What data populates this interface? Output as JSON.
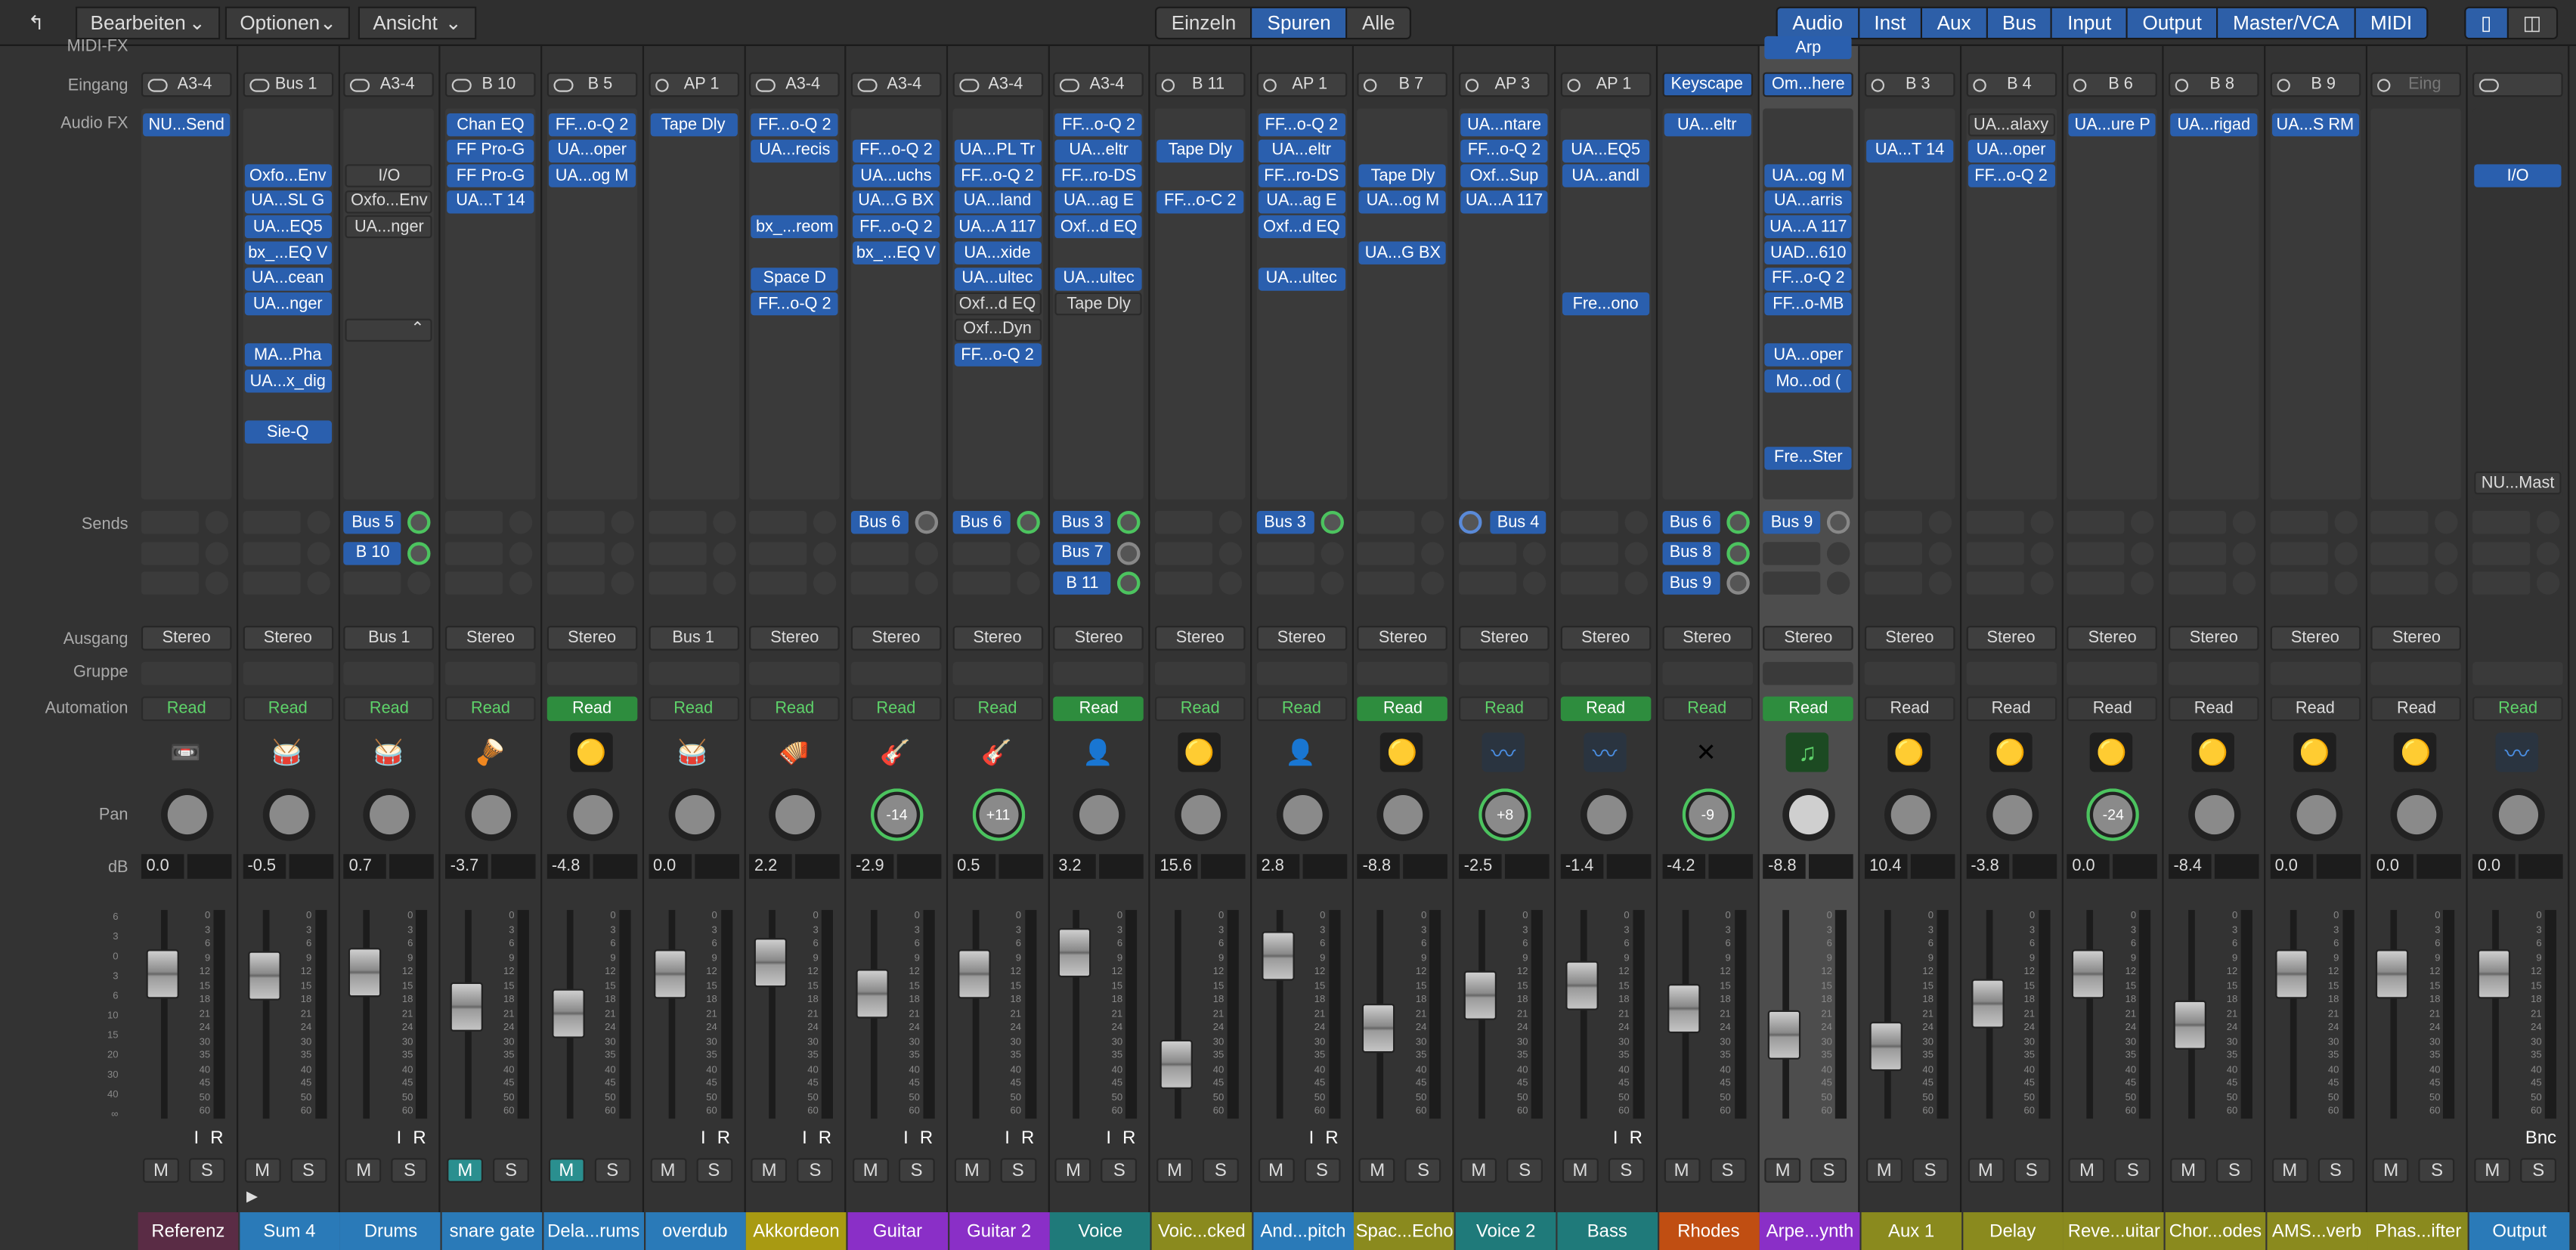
{
  "toolbar": {
    "back_icon": "back-arrow-icon",
    "menus": [
      "Bearbeiten",
      "Optionen",
      "Ansicht"
    ],
    "view_filter": [
      "Einzeln",
      "Spuren",
      "Alle"
    ],
    "view_filter_active": "Spuren",
    "types": [
      "Audio",
      "Inst",
      "Aux",
      "Bus",
      "Input",
      "Output",
      "Master/VCA",
      "MIDI"
    ],
    "types_active": [
      "Audio"
    ]
  },
  "row_labels": {
    "midi_fx": "MIDI-FX",
    "input": "Eingang",
    "audio_fx": "Audio FX",
    "sends": "Sends",
    "output": "Ausgang",
    "group": "Gruppe",
    "automation": "Automation",
    "pan": "Pan",
    "db": "dB"
  },
  "fader_scale": [
    "6",
    "3",
    "0",
    "3",
    "6",
    "10",
    "15",
    "20",
    "30",
    "40",
    "∞"
  ],
  "meter_scale": [
    "0",
    "3",
    "6",
    "9",
    "12",
    "15",
    "18",
    "21",
    "24",
    "30",
    "35",
    "40",
    "45",
    "50",
    "60"
  ],
  "strips": [
    {
      "name": "Referenz",
      "color": "#5a2c45",
      "input": "A3-4",
      "stereo": true,
      "fx": [
        {
          "s": 0,
          "t": "NU...Send",
          "c": "b"
        }
      ],
      "sends": [],
      "output": "Stereo",
      "automation": "Read",
      "auto_style": "n",
      "icon": "tape-machine-icon",
      "pan": "",
      "db": "0.0",
      "fader_level": 0.78,
      "ir": true
    },
    {
      "name": "Sum 4",
      "color": "#2a7ab8",
      "input": "Bus 1",
      "stereo": true,
      "fx": [
        {
          "s": 2,
          "t": "Oxfo...Env",
          "c": "b"
        },
        {
          "s": 3,
          "t": "UA...SL G",
          "c": "b"
        },
        {
          "s": 4,
          "t": "UA...EQ5",
          "c": "b"
        },
        {
          "s": 5,
          "t": "bx_...EQ V",
          "c": "b"
        },
        {
          "s": 6,
          "t": "UA...cean",
          "c": "b"
        },
        {
          "s": 7,
          "t": "UA...nger",
          "c": "b"
        },
        {
          "s": 9,
          "t": "MA...Pha",
          "c": "b"
        },
        {
          "s": 10,
          "t": "UA...x_dig",
          "c": "b"
        },
        {
          "s": 12,
          "t": "Sie-Q",
          "c": "b"
        }
      ],
      "sends": [],
      "output": "Stereo",
      "automation": "Read",
      "auto_style": "n",
      "icon": "drum-kit-icon",
      "pan": "",
      "db": "-0.5",
      "fader_level": 0.77
    },
    {
      "name": "Drums",
      "color": "#2a7ab8",
      "input": "A3-4",
      "stereo": true,
      "fx": [
        {
          "s": 2,
          "t": "I/O",
          "c": "g"
        },
        {
          "s": 3,
          "t": "Oxfo...Env",
          "c": "g"
        },
        {
          "s": 4,
          "t": "UA...nger",
          "c": "g"
        },
        {
          "s": 8,
          "t": "",
          "c": "g"
        }
      ],
      "sends": [
        {
          "t": "Bus 5",
          "k": "g"
        },
        {
          "t": "B 10",
          "k": "g"
        }
      ],
      "output": "Bus 1",
      "automation": "Read",
      "auto_style": "n",
      "icon": "drum-kit-icon",
      "pan": "",
      "db": "0.7",
      "fader_level": 0.79,
      "ir": true
    },
    {
      "name": "snare gate",
      "color": "#2a7ab8",
      "input": "B 10",
      "stereo": true,
      "fx": [
        {
          "s": 0,
          "t": "Chan EQ",
          "c": "b"
        },
        {
          "s": 1,
          "t": "FF Pro-G",
          "c": "b"
        },
        {
          "s": 2,
          "t": "FF Pro-G",
          "c": "b"
        },
        {
          "s": 3,
          "t": "UA...T 14",
          "c": "b"
        }
      ],
      "sends": [],
      "output": "Stereo",
      "automation": "Read",
      "auto_style": "n",
      "icon": "snare-drum-icon",
      "pan": "",
      "db": "-3.7",
      "fader_level": 0.6,
      "mute_on": true
    },
    {
      "name": "Dela...rums",
      "color": "#2a7ab8",
      "input": "B 5",
      "stereo": true,
      "fx": [
        {
          "s": 0,
          "t": "FF...o-Q 2",
          "c": "b"
        },
        {
          "s": 1,
          "t": "UA...oper",
          "c": "b"
        },
        {
          "s": 2,
          "t": "UA...og M",
          "c": "b"
        }
      ],
      "sends": [],
      "output": "Stereo",
      "automation": "Read",
      "auto_style": "h",
      "icon": "plugin-knob-icon",
      "pan": "",
      "db": "-4.8",
      "fader_level": 0.56,
      "mute_on": true
    },
    {
      "name": "overdub",
      "color": "#2a7ab8",
      "input": "AP 1",
      "stereo": false,
      "fx": [
        {
          "s": 0,
          "t": "Tape Dly",
          "c": "b"
        }
      ],
      "sends": [],
      "output": "Bus 1",
      "automation": "Read",
      "auto_style": "n",
      "icon": "drum-kit-icon",
      "pan": "",
      "db": "0.0",
      "fader_level": 0.78,
      "ir": true
    },
    {
      "name": "Akkordeon",
      "color": "#a89a12",
      "input": "A3-4",
      "stereo": true,
      "fx": [
        {
          "s": 0,
          "t": "FF...o-Q 2",
          "c": "b"
        },
        {
          "s": 1,
          "t": "UA...recis",
          "c": "b"
        },
        {
          "s": 4,
          "t": "bx_...reom",
          "c": "b"
        },
        {
          "s": 6,
          "t": "Space D",
          "c": "b"
        },
        {
          "s": 7,
          "t": "FF...o-Q 2",
          "c": "b"
        }
      ],
      "sends": [],
      "output": "Stereo",
      "automation": "Read",
      "auto_style": "n",
      "icon": "accordion-icon",
      "pan": "",
      "db": "2.2",
      "fader_level": 0.85,
      "ir": true
    },
    {
      "name": "Guitar",
      "color": "#8a2fc7",
      "input": "A3-4",
      "stereo": true,
      "fx": [
        {
          "s": 1,
          "t": "FF...o-Q 2",
          "c": "b"
        },
        {
          "s": 2,
          "t": "UA...uchs",
          "c": "b"
        },
        {
          "s": 3,
          "t": "UA...G BX",
          "c": "b"
        },
        {
          "s": 4,
          "t": "FF...o-Q 2",
          "c": "b"
        },
        {
          "s": 5,
          "t": "bx_...EQ V",
          "c": "b"
        }
      ],
      "sends": [
        {
          "t": "Bus 6",
          "k": "gr"
        }
      ],
      "output": "Stereo",
      "automation": "Read",
      "auto_style": "n",
      "icon": "electric-guitar-icon",
      "pan": "-14",
      "db": "-2.9",
      "fader_level": 0.67,
      "ir": true
    },
    {
      "name": "Guitar 2",
      "color": "#8a2fc7",
      "input": "A3-4",
      "stereo": true,
      "fx": [
        {
          "s": 1,
          "t": "UA...PL Tr",
          "c": "b"
        },
        {
          "s": 2,
          "t": "FF...o-Q 2",
          "c": "b"
        },
        {
          "s": 3,
          "t": "UA...land",
          "c": "b"
        },
        {
          "s": 4,
          "t": "UA...A 117",
          "c": "b"
        },
        {
          "s": 5,
          "t": "UA...xide",
          "c": "b"
        },
        {
          "s": 6,
          "t": "UA...ultec",
          "c": "b"
        },
        {
          "s": 7,
          "t": "Oxf...d EQ",
          "c": "g"
        },
        {
          "s": 8,
          "t": "Oxf...Dyn",
          "c": "g"
        },
        {
          "s": 9,
          "t": "FF...o-Q 2",
          "c": "b"
        }
      ],
      "sends": [
        {
          "t": "Bus 6",
          "k": "g"
        }
      ],
      "output": "Stereo",
      "automation": "Read",
      "auto_style": "n",
      "icon": "electric-guitar-icon",
      "pan": "+11",
      "db": "0.5",
      "fader_level": 0.78,
      "ir": true
    },
    {
      "name": "Voice",
      "color": "#1f7a7a",
      "input": "A3-4",
      "stereo": true,
      "fx": [
        {
          "s": 0,
          "t": "FF...o-Q 2",
          "c": "b"
        },
        {
          "s": 1,
          "t": "UA...eltr",
          "c": "b"
        },
        {
          "s": 2,
          "t": "FF...ro-DS",
          "c": "b"
        },
        {
          "s": 3,
          "t": "UA...ag E",
          "c": "b"
        },
        {
          "s": 4,
          "t": "Oxf...d EQ",
          "c": "b"
        },
        {
          "s": 6,
          "t": "UA...ultec",
          "c": "b"
        },
        {
          "s": 7,
          "t": "Tape Dly",
          "c": "g"
        }
      ],
      "sends": [
        {
          "t": "Bus 3",
          "k": "g"
        },
        {
          "t": "Bus 7",
          "k": "gr"
        },
        {
          "t": "B 11",
          "k": "g"
        }
      ],
      "output": "Stereo",
      "automation": "Read",
      "auto_style": "h",
      "icon": "singer-icon",
      "pan": "",
      "db": "3.2",
      "fader_level": 0.9,
      "ir": true
    },
    {
      "name": "Voic...cked",
      "color": "#8a8a1e",
      "input": "B 11",
      "stereo": false,
      "fx": [
        {
          "s": 1,
          "t": "Tape Dly",
          "c": "b"
        },
        {
          "s": 3,
          "t": "FF...o-C 2",
          "c": "b"
        }
      ],
      "sends": [],
      "output": "Stereo",
      "automation": "Read",
      "auto_style": "n",
      "icon": "plugin-knob-icon",
      "pan": "",
      "db": "15.6",
      "fader_level": 0.28
    },
    {
      "name": "And...pitch",
      "color": "#2a7ab8",
      "input": "AP 1",
      "stereo": false,
      "fx": [
        {
          "s": 0,
          "t": "FF...o-Q 2",
          "c": "b"
        },
        {
          "s": 1,
          "t": "UA...eltr",
          "c": "b"
        },
        {
          "s": 2,
          "t": "FF...ro-DS",
          "c": "b"
        },
        {
          "s": 3,
          "t": "UA...ag E",
          "c": "b"
        },
        {
          "s": 4,
          "t": "Oxf...d EQ",
          "c": "b"
        },
        {
          "s": 6,
          "t": "UA...ultec",
          "c": "b"
        }
      ],
      "sends": [
        {
          "t": "Bus 3",
          "k": "g"
        }
      ],
      "output": "Stereo",
      "automation": "Read",
      "auto_style": "n",
      "icon": "singer-icon",
      "pan": "",
      "db": "2.8",
      "fader_level": 0.88,
      "ir": true
    },
    {
      "name": "Spac...Echo",
      "color": "#8a8a1e",
      "input": "B 7",
      "stereo": false,
      "fx": [
        {
          "s": 2,
          "t": "Tape Dly",
          "c": "b"
        },
        {
          "s": 3,
          "t": "UA...og M",
          "c": "b"
        },
        {
          "s": 5,
          "t": "UA...G BX",
          "c": "b"
        }
      ],
      "sends": [],
      "output": "Stereo",
      "automation": "Read",
      "auto_style": "h",
      "icon": "plugin-knob-icon",
      "pan": "",
      "db": "-8.8",
      "fader_level": 0.48
    },
    {
      "name": "Voice 2",
      "color": "#1f7a7a",
      "input": "AP 3",
      "stereo": false,
      "fx": [
        {
          "s": 0,
          "t": "UA...ntare",
          "c": "b"
        },
        {
          "s": 1,
          "t": "FF...o-Q 2",
          "c": "b"
        },
        {
          "s": 2,
          "t": "Oxf...Sup",
          "c": "b"
        },
        {
          "s": 3,
          "t": "UA...A 117",
          "c": "b"
        }
      ],
      "sends": [
        {
          "t": "Bus 4",
          "k": "b",
          "left": true
        }
      ],
      "output": "Stereo",
      "automation": "Read",
      "auto_style": "n",
      "icon": "audio-waveform-icon",
      "pan": "+8",
      "db": "-2.5",
      "fader_level": 0.66
    },
    {
      "name": "Bass",
      "color": "#1f7a7a",
      "input": "AP 1",
      "stereo": false,
      "fx": [
        {
          "s": 1,
          "t": "UA...EQ5",
          "c": "b"
        },
        {
          "s": 2,
          "t": "UA...andl",
          "c": "b"
        },
        {
          "s": 7,
          "t": "Fre...ono",
          "c": "b"
        }
      ],
      "sends": [],
      "output": "Stereo",
      "automation": "Read",
      "auto_style": "h",
      "icon": "audio-waveform-icon",
      "pan": "",
      "db": "-1.4",
      "fader_level": 0.72,
      "ir": true
    },
    {
      "name": "Rhodes",
      "color": "#c04e12",
      "input": "Keyscape",
      "stereo": false,
      "fx": [
        {
          "s": 0,
          "t": "UA...eltr",
          "c": "b"
        }
      ],
      "sends": [
        {
          "t": "Bus 6",
          "k": "g"
        },
        {
          "t": "Bus 8",
          "k": "g"
        },
        {
          "t": "Bus 9",
          "k": "gr"
        }
      ],
      "output": "Stereo",
      "automation": "Read",
      "auto_style": "n",
      "icon": "keyboard-stand-icon",
      "pan": "-9",
      "db": "-4.2",
      "fader_level": 0.59
    },
    {
      "name": "Arpe...ynth",
      "color": "#8a2fc7",
      "input": "Om...here",
      "midi_fx": "Arp",
      "selected": true,
      "stereo": false,
      "fx": [
        {
          "s": 2,
          "t": "UA...og M",
          "c": "b"
        },
        {
          "s": 3,
          "t": "UA...arris",
          "c": "b"
        },
        {
          "s": 4,
          "t": "UA...A 117",
          "c": "b"
        },
        {
          "s": 5,
          "t": "UAD...610",
          "c": "b"
        },
        {
          "s": 6,
          "t": "FF...o-Q 2",
          "c": "b"
        },
        {
          "s": 7,
          "t": "FF...o-MB",
          "c": "b"
        },
        {
          "s": 9,
          "t": "UA...oper",
          "c": "b"
        },
        {
          "s": 10,
          "t": "Mo...od (",
          "c": "b"
        },
        {
          "s": 13,
          "t": "Fre...Ster",
          "c": "b"
        }
      ],
      "sends": [
        {
          "t": "Bus 9",
          "k": "gr"
        }
      ],
      "output": "Stereo",
      "automation": "Read",
      "auto_style": "h",
      "icon": "music-note-icon",
      "pan": "",
      "db": "-8.8",
      "fader_level": 0.45
    },
    {
      "name": "Aux 1",
      "color": "#8a8a1e",
      "input": "B 3",
      "stereo": false,
      "fx": [
        {
          "s": 1,
          "t": "UA...T 14",
          "c": "b"
        }
      ],
      "sends": [],
      "output": "Stereo",
      "automation": "Read",
      "auto_style": "w",
      "icon": "plugin-knob-icon",
      "pan": "",
      "db": "10.4",
      "fader_level": 0.38
    },
    {
      "name": "Delay",
      "color": "#8a8a1e",
      "input": "B 4",
      "stereo": false,
      "fx": [
        {
          "s": 0,
          "t": "UA...alaxy",
          "c": "g"
        },
        {
          "s": 1,
          "t": "UA...oper",
          "c": "b"
        },
        {
          "s": 2,
          "t": "FF...o-Q 2",
          "c": "b"
        }
      ],
      "sends": [],
      "output": "Stereo",
      "automation": "Read",
      "auto_style": "w",
      "icon": "plugin-knob-icon",
      "pan": "",
      "db": "-3.8",
      "fader_level": 0.62
    },
    {
      "name": "Reve...uitar",
      "color": "#8a8a1e",
      "input": "B 6",
      "stereo": false,
      "fx": [
        {
          "s": 0,
          "t": "UA...ure P",
          "c": "b"
        }
      ],
      "sends": [],
      "output": "Stereo",
      "automation": "Read",
      "auto_style": "w",
      "icon": "plugin-knob-icon",
      "pan": "-24",
      "db": "0.0",
      "fader_level": 0.78
    },
    {
      "name": "Chor...odes",
      "color": "#8a8a1e",
      "input": "B 8",
      "stereo": false,
      "fx": [
        {
          "s": 0,
          "t": "UA...rigad",
          "c": "b"
        }
      ],
      "sends": [],
      "output": "Stereo",
      "automation": "Read",
      "auto_style": "w",
      "icon": "plugin-knob-icon",
      "pan": "",
      "db": "-8.4",
      "fader_level": 0.5
    },
    {
      "name": "AMS...verb",
      "color": "#8a8a1e",
      "input": "B 9",
      "stereo": false,
      "fx": [
        {
          "s": 0,
          "t": "UA...S RM",
          "c": "b"
        }
      ],
      "sends": [],
      "output": "Stereo",
      "automation": "Read",
      "auto_style": "w",
      "icon": "plugin-knob-icon",
      "pan": "",
      "db": "0.0",
      "fader_level": 0.78
    },
    {
      "name": "Phas...ifter",
      "color": "#8a8a1e",
      "input": "Eing",
      "stereo": false,
      "fx": [],
      "sends": [],
      "output": "Stereo",
      "automation": "Read",
      "auto_style": "w",
      "icon": "plugin-knob-icon",
      "pan": "",
      "db": "0.0",
      "fader_level": 0.78
    },
    {
      "name": "Output",
      "color": "#2a7ab8",
      "input": "",
      "stereo": true,
      "fx": [
        {
          "s": 2,
          "t": "I/O",
          "c": "b"
        },
        {
          "s": 14,
          "t": "NU...Mast",
          "c": "g"
        }
      ],
      "sends": [],
      "output": "",
      "automation": "Read",
      "auto_style": "n",
      "icon": "audio-waveform-icon",
      "pan": "",
      "db": "0.0",
      "fader_level": 0.78,
      "bnc": "Bnc"
    }
  ]
}
